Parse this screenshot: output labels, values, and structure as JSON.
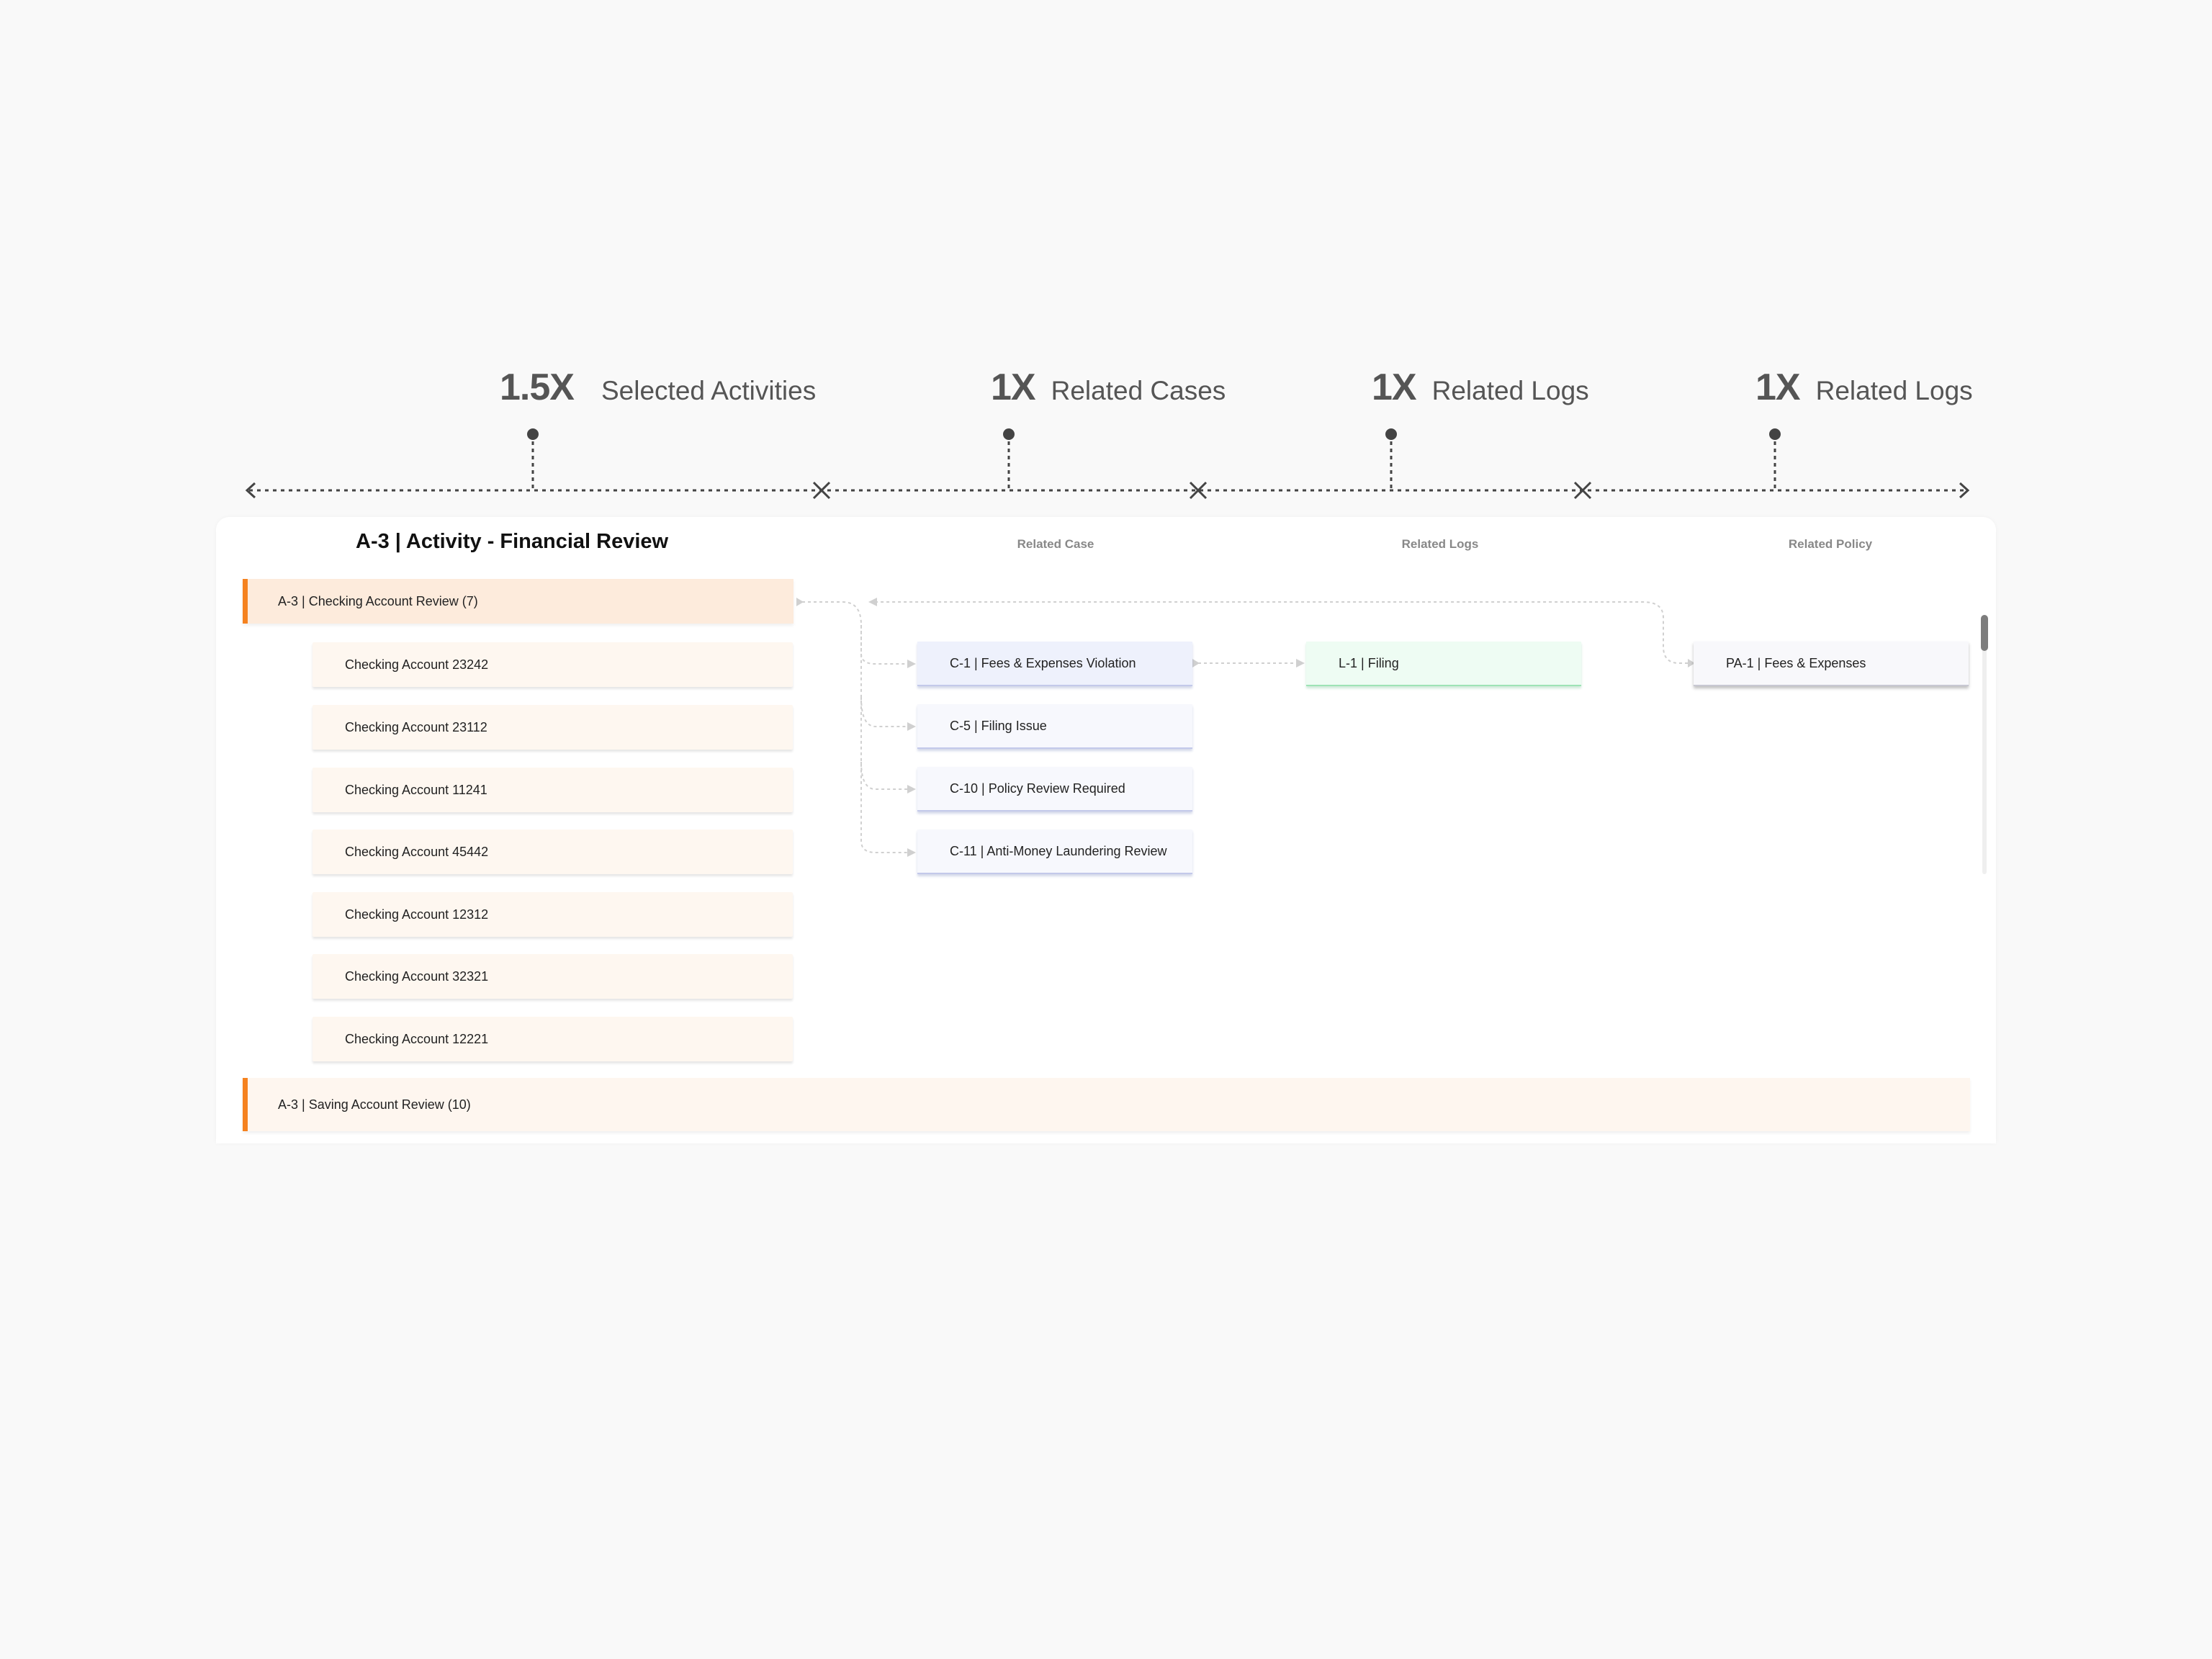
{
  "scale": {
    "annotations": [
      {
        "multiplier": "1.5X",
        "label": "Selected Activities"
      },
      {
        "multiplier": "1X",
        "label": "Related Cases"
      },
      {
        "multiplier": "1X",
        "label": "Related Logs"
      },
      {
        "multiplier": "1X",
        "label": "Related Logs"
      }
    ]
  },
  "card": {
    "title": "A-3 | Activity - Financial Review",
    "columns": {
      "related_case": "Related Case",
      "related_logs": "Related Logs",
      "related_policy": "Related Policy"
    },
    "groups": [
      {
        "label": "A-3 | Checking Account Review (7)",
        "children": [
          "Checking Account 23242",
          "Checking Account 23112",
          "Checking Account 11241",
          "Checking Account 45442",
          "Checking Account 12312",
          "Checking Account 32321",
          "Checking Account 12221"
        ]
      },
      {
        "label": "A-3 | Saving Account Review (10)",
        "children": []
      }
    ],
    "cases": [
      "C-1 | Fees & Expenses Violation",
      "C-5 | Filing Issue",
      "C-10 | Policy Review Required",
      "C-11 | Anti-Money Laundering Review"
    ],
    "logs": [
      "L-1 | Filing"
    ],
    "policies": [
      "PA-1 | Fees & Expenses"
    ]
  },
  "colors": {
    "accent": "#f5821f",
    "group_bg": "#fdebdc",
    "case_border": "#c3c9ea",
    "log_border": "#9ee3b6",
    "connector": "#cfcfcf"
  }
}
